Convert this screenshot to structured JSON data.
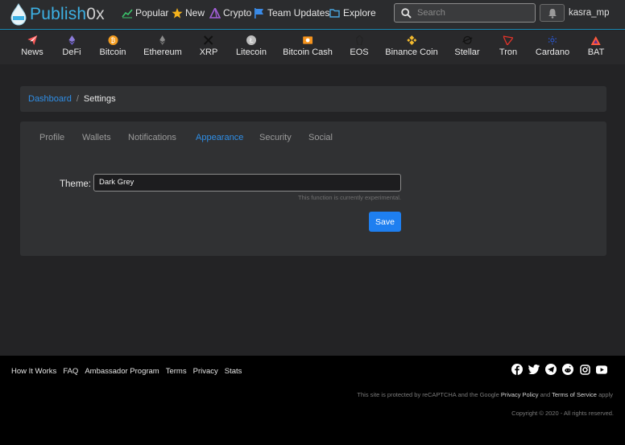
{
  "header": {
    "logo_main": "Publish",
    "logo_suffix": "0x",
    "nav": [
      {
        "label": "Popular",
        "icon": "trending-icon"
      },
      {
        "label": "New",
        "icon": "star-icon"
      },
      {
        "label": "Crypto",
        "icon": "pyramid-icon"
      },
      {
        "label": "Team Updates",
        "icon": "flag-icon"
      },
      {
        "label": "Explore",
        "icon": "folder-icon"
      }
    ],
    "search_placeholder": "Search",
    "username": "kasra_mp"
  },
  "coins": [
    {
      "label": "News",
      "icon": "paper-plane-icon",
      "color": "#e9e9e9"
    },
    {
      "label": "DeFi",
      "icon": "ethereum-purple-icon",
      "color": "#8b7bd8"
    },
    {
      "label": "Bitcoin",
      "icon": "bitcoin-icon",
      "color": "#f39c1f"
    },
    {
      "label": "Ethereum",
      "icon": "ethereum-icon",
      "color": "#9a9a9a"
    },
    {
      "label": "XRP",
      "icon": "xrp-icon",
      "color": "#2a2a2a"
    },
    {
      "label": "Litecoin",
      "icon": "litecoin-icon",
      "color": "#b8b8b8"
    },
    {
      "label": "Bitcoin Cash",
      "icon": "bitcoin-cash-icon",
      "color": "#f7941d"
    },
    {
      "label": "EOS",
      "icon": "eos-icon",
      "color": "#333333"
    },
    {
      "label": "Binance Coin",
      "icon": "binance-icon",
      "color": "#f3ba2f"
    },
    {
      "label": "Stellar",
      "icon": "stellar-icon",
      "color": "#222222"
    },
    {
      "label": "Tron",
      "icon": "tron-icon",
      "color": "#e4342a"
    },
    {
      "label": "Cardano",
      "icon": "cardano-icon",
      "color": "#2a5ada"
    },
    {
      "label": "BAT",
      "icon": "bat-icon",
      "color": "#ff5a3c"
    }
  ],
  "breadcrumb": {
    "link": "Dashboard",
    "separator": "/",
    "current": "Settings"
  },
  "tabs": [
    "Profile",
    "Wallets",
    "Notifications",
    "Appearance",
    "Security",
    "Social"
  ],
  "active_tab": "Appearance",
  "form": {
    "theme_label": "Theme:",
    "theme_value": "Dark Grey",
    "hint": "This function is currently experimental.",
    "save_label": "Save"
  },
  "footer": {
    "links": [
      "How It Works",
      "FAQ",
      "Ambassador Program",
      "Terms",
      "Privacy",
      "Stats"
    ],
    "social": [
      "facebook-icon",
      "twitter-icon",
      "telegram-icon",
      "reddit-icon",
      "instagram-icon",
      "youtube-icon"
    ],
    "recaptcha_prefix": "This site is protected by reCAPTCHA and the Google",
    "privacy_policy": "Privacy Policy",
    "and": "and",
    "terms_of_service": "Terms of Service",
    "apply": "apply",
    "copyright": "Copyright © 2020 - All rights reserved."
  },
  "colors": {
    "accent": "#2f8ee6",
    "save_button": "#1e7ff0",
    "logo": "#3db1e4"
  }
}
